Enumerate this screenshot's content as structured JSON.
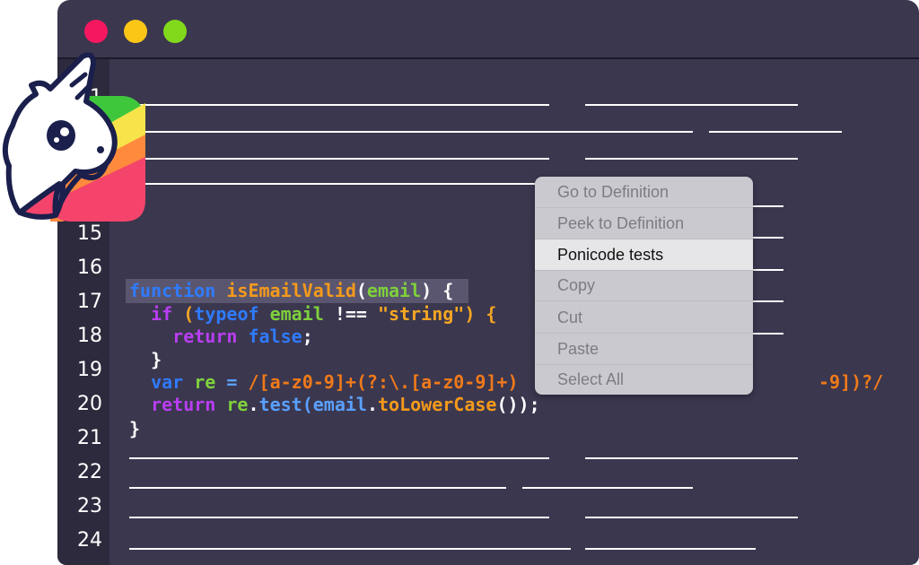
{
  "window": {
    "traffic_lights": [
      "#f5175f",
      "#fbc616",
      "#82d91c"
    ]
  },
  "gutter": {
    "line_numbers": [
      "1",
      "15",
      "16",
      "17",
      "18",
      "19",
      "20",
      "21",
      "22",
      "23",
      "24"
    ]
  },
  "code": {
    "l17": {
      "k": "function",
      "fn": "isEmailValid",
      "p1": "(",
      "arg": "email",
      "p2": ") {"
    },
    "l18": {
      "k": "if",
      "p1": " (",
      "k2": "typeof",
      "sp": " ",
      "v": "email",
      "op": " !== ",
      "s": "\"string\"",
      "p2": ") {"
    },
    "l19": {
      "k": "return",
      "sp": " ",
      "v": "false",
      "p": ";"
    },
    "l20": {
      "b": "}"
    },
    "l21": {
      "k": "var",
      "sp": " ",
      "v": "re",
      "op": " = ",
      "r1": "/[a-z0-9]+(?:\\.[a-z0-9]+)",
      "r2": "-9])?/"
    },
    "l22": {
      "k": "return",
      "sp": " ",
      "v": "re",
      "dot": ".",
      "m": "test",
      "p1": "(",
      "v2": "email",
      "dot2": ".",
      "m2": "toLowerCase",
      "p2": "());"
    },
    "l23": {
      "b": "}"
    }
  },
  "context_menu": {
    "items": [
      {
        "label": "Go to Definition",
        "enabled": false
      },
      {
        "label": "Peek to Definition",
        "enabled": false
      },
      {
        "label": "Ponicode tests",
        "enabled": true
      },
      {
        "label": "Copy",
        "enabled": false
      },
      {
        "label": "Cut",
        "enabled": false
      },
      {
        "label": "Paste",
        "enabled": false
      },
      {
        "label": "Select All",
        "enabled": false
      }
    ]
  },
  "logo": {
    "icon": "unicorn-logo-icon",
    "colors": [
      "#3fc73c",
      "#f7e44a",
      "#ff8a3d",
      "#f5446b",
      "#1a1f4c"
    ]
  }
}
